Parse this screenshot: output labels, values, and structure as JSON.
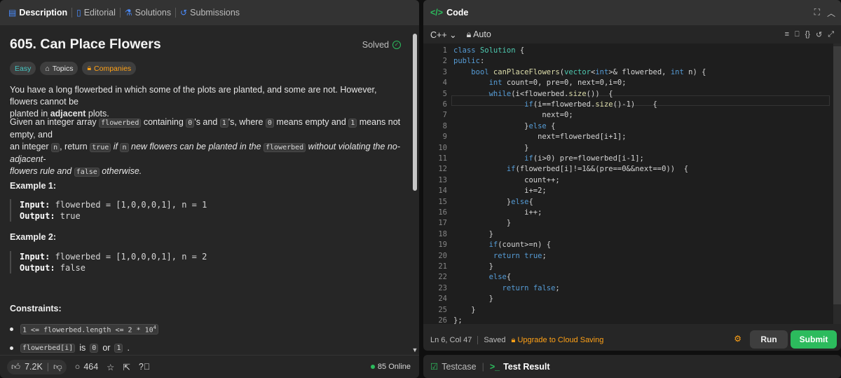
{
  "left": {
    "tabs": [
      {
        "label": "Description",
        "icon": "description-icon",
        "active": true
      },
      {
        "label": "Editorial",
        "icon": "book-icon"
      },
      {
        "label": "Solutions",
        "icon": "flask-icon"
      },
      {
        "label": "Submissions",
        "icon": "history-icon"
      }
    ],
    "problem": {
      "title": "605. Can Place Flowers",
      "status": "Solved",
      "tags": [
        "Easy",
        "Topics",
        "Companies"
      ]
    },
    "description": {
      "p1a": "You have a long flowerbed in which some of the plots are planted, and some are not. However, flowers cannot be",
      "p1b": "planted in ",
      "p1c": "adjacent",
      "p1d": " plots.",
      "p2a": "Given an integer array ",
      "p2b": "flowerbed",
      "p2c": " containing ",
      "p2d": "0",
      "p2e": "'s and ",
      "p2f": "1",
      "p2g": "'s, where ",
      "p2h": "0",
      "p2i": " means empty and ",
      "p2j": "1",
      "p2k": " means not empty, and",
      "p3a": "an integer ",
      "p3b": "n",
      "p3c": ", return ",
      "p3d": "true",
      "p3e": " if ",
      "p3f": "n",
      "p3g": " new flowers can be planted in the ",
      "p3h": "flowerbed",
      "p3i": " without violating the no-adjacent-",
      "p4a": "flowers rule and ",
      "p4b": "false",
      "p4c": " otherwise."
    },
    "examples": [
      {
        "title": "Example 1:",
        "input_label": "Input:",
        "input": " flowerbed = [1,0,0,0,1], n = 1",
        "output_label": "Output:",
        "output": " true"
      },
      {
        "title": "Example 2:",
        "input_label": "Input:",
        "input": " flowerbed = [1,0,0,0,1], n = 2",
        "output_label": "Output:",
        "output": " false"
      }
    ],
    "constraints": {
      "title": "Constraints:",
      "c1": "1 <= flowerbed.length <= 2 * 10",
      "c1sup": "4",
      "c2a": "flowerbed[i]",
      "c2b": " is ",
      "c2c": "0",
      "c2d": " or ",
      "c2e": "1",
      "c2f": "."
    },
    "footer": {
      "likes": "7.2K",
      "comments": "464",
      "online": "85 Online"
    }
  },
  "right": {
    "header": {
      "label": "Code"
    },
    "toolbar": {
      "language": "C++",
      "mode": "Auto"
    },
    "code": [
      "class Solution {",
      "public:",
      "    bool canPlaceFlowers(vector<int>& flowerbed, int n) {",
      "        int count=0, pre=0, next=0,i=0;",
      "        while(i<flowerbed.size())  {",
      "                if(i==flowerbed.size()-1)    {",
      "                    next=0;",
      "                }else {",
      "                   next=flowerbed[i+1];",
      "                }",
      "                if(i>0) pre=flowerbed[i-1];",
      "            if(flowerbed[i]!=1&&(pre==0&&next==0))  {",
      "                count++;",
      "                i+=2;",
      "            }else{",
      "                i++;",
      "            }",
      "        }",
      "        if(count>=n) {",
      "         return true;",
      "        }",
      "        else{",
      "           return false;",
      "        }",
      "    }",
      "};"
    ],
    "status": {
      "position": "Ln 6, Col 47",
      "saved": "Saved",
      "upgrade": "Upgrade to Cloud Saving"
    },
    "buttons": {
      "run": "Run",
      "submit": "Submit"
    }
  },
  "bottom": {
    "tabs": [
      {
        "label": "Testcase",
        "icon": "checkbox-icon"
      },
      {
        "label": "Test Result",
        "icon": "terminal-icon",
        "active": true
      }
    ]
  },
  "colors": {
    "accent_green": "#2cbb5d",
    "accent_orange": "#ffa116",
    "easy": "#46c6c2",
    "tab_blue": "#4a8cff"
  }
}
